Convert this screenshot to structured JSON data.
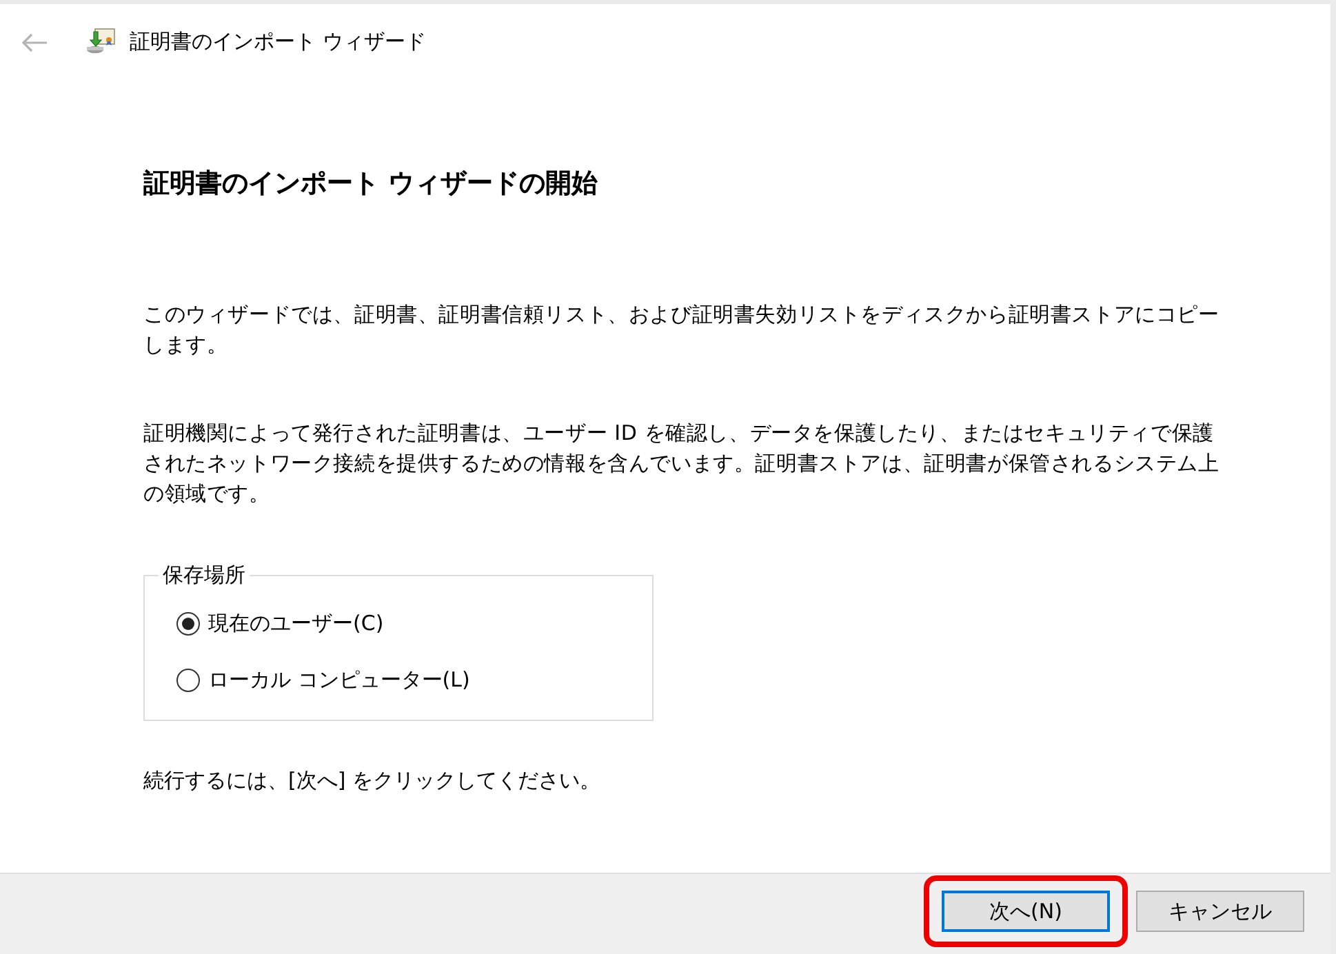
{
  "window": {
    "title": "証明書のインポート ウィザード"
  },
  "heading": "証明書のインポート ウィザードの開始",
  "paragraphs": [
    "このウィザードでは、証明書、証明書信頼リスト、および証明書失効リストをディスクから証明書ストアにコピーします。",
    "証明機関によって発行された証明書は、ユーザー ID を確認し、データを保護したり、またはセキュリティで保護されたネットワーク接続を提供するための情報を含んでいます。証明書ストアは、証明書が保管されるシステム上の領域です。"
  ],
  "store_location": {
    "label": "保存場所",
    "options": [
      {
        "label": "現在のユーザー(C)",
        "selected": true
      },
      {
        "label": "ローカル コンピューター(L)",
        "selected": false
      }
    ]
  },
  "instruction": "続行するには、[次へ] をクリックしてください。",
  "buttons": [
    {
      "label": "次へ(N)",
      "default": true,
      "highlighted": true
    },
    {
      "label": "キャンセル",
      "default": false,
      "highlighted": false
    }
  ]
}
